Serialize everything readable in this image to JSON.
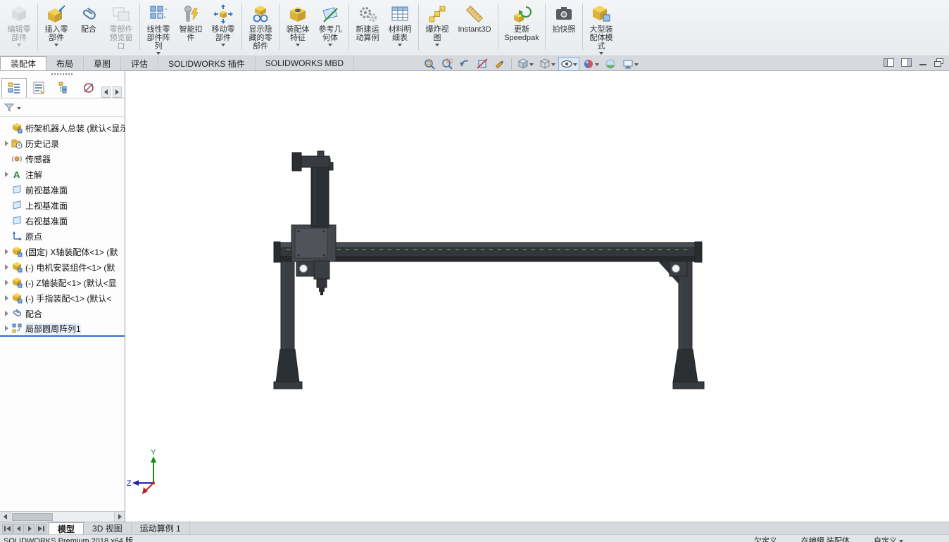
{
  "cmd": {
    "buttons": [
      {
        "label": "编辑零部件",
        "icon": "edit-component-icon",
        "disabled": true,
        "dropdown": true
      },
      {
        "label": "插入零部件",
        "icon": "insert-component-icon",
        "dropdown": true
      },
      {
        "label": "配合",
        "icon": "mate-icon"
      },
      {
        "label": "零部件预览窗口",
        "icon": "component-preview-icon",
        "disabled": true
      },
      {
        "label": "线性零部件阵列",
        "icon": "linear-pattern-icon",
        "dropdown": true
      },
      {
        "label": "智能扣件",
        "icon": "smart-fasteners-icon"
      },
      {
        "label": "移动零部件",
        "icon": "move-component-icon",
        "dropdown": true
      },
      {
        "label": "显示隐藏的零部件",
        "icon": "show-hidden-components-icon"
      },
      {
        "label": "装配体特征",
        "icon": "assembly-features-icon",
        "dropdown": true
      },
      {
        "label": "参考几何体",
        "icon": "reference-geometry-icon",
        "dropdown": true
      },
      {
        "label": "新建运动算例",
        "icon": "new-motion-study-icon"
      },
      {
        "label": "材料明细表",
        "icon": "bill-of-materials-icon",
        "dropdown": true
      },
      {
        "label": "爆炸视图",
        "icon": "exploded-view-icon",
        "dropdown": true
      },
      {
        "label": "Instant3D",
        "icon": "instant3d-icon"
      },
      {
        "label": "更新 Speedpak",
        "icon": "update-speedpak-icon"
      },
      {
        "label": "拍快照",
        "icon": "take-snapshot-icon"
      },
      {
        "label": "大型装配体模式",
        "icon": "large-assembly-mode-icon",
        "dropdown": true
      }
    ]
  },
  "ribbon": {
    "tabs": [
      {
        "label": "装配体",
        "active": true
      },
      {
        "label": "布局"
      },
      {
        "label": "草图"
      },
      {
        "label": "评估"
      },
      {
        "label": "SOLIDWORKS 插件"
      },
      {
        "label": "SOLIDWORKS MBD"
      }
    ]
  },
  "hud": {
    "icons": [
      "zoom-fit-icon",
      "zoom-area-icon",
      "previous-view-icon",
      "section-view-icon",
      "magnify-icon",
      "view-orientation-icon",
      "display-style-icon",
      "hide-show-items-icon",
      "edit-appearance-icon",
      "apply-scene-icon",
      "view-settings-icon"
    ]
  },
  "window_controls": {
    "icons": [
      "pane-left-icon",
      "pane-right-icon",
      "minimize-commandmanager-icon",
      "restore-pane-icon"
    ]
  },
  "panel": {
    "tabs": [
      "featuremanager-tree",
      "propertymanager",
      "configurationmanager",
      "dimxpertmanager"
    ],
    "filter_icon": "filter-funnel-icon"
  },
  "tree": {
    "items": [
      {
        "label": "桁架机器人总装 (默认<显示",
        "icon": "assembly-icon"
      },
      {
        "label": "历史记录",
        "icon": "history-folder-icon",
        "expandable": true
      },
      {
        "label": "传感器",
        "icon": "sensors-icon"
      },
      {
        "label": "注解",
        "icon": "annotations-icon",
        "expandable": true
      },
      {
        "label": "前视基准面",
        "icon": "plane-icon"
      },
      {
        "label": "上视基准面",
        "icon": "plane-icon"
      },
      {
        "label": "右视基准面",
        "icon": "plane-icon"
      },
      {
        "label": "原点",
        "icon": "origin-icon"
      },
      {
        "label": "(固定) X轴装配体<1> (默",
        "icon": "component-icon",
        "expandable": true
      },
      {
        "label": "(-) 电机安装组件<1> (默",
        "icon": "component-icon",
        "expandable": true
      },
      {
        "label": "(-) Z轴装配<1> (默认<显",
        "icon": "component-icon",
        "expandable": true
      },
      {
        "label": "(-) 手指装配<1> (默认<",
        "icon": "component-icon",
        "expandable": true
      },
      {
        "label": "配合",
        "icon": "mates-icon",
        "expandable": true
      },
      {
        "label": "局部圆周阵列1",
        "icon": "pattern-icon",
        "expandable": true,
        "selected": true
      }
    ]
  },
  "viewport": {
    "triad_y": "Y",
    "triad_z": "Z"
  },
  "doc": {
    "tabs": [
      {
        "label": "模型",
        "active": true
      },
      {
        "label": "3D 视图"
      },
      {
        "label": "运动算例 1"
      }
    ]
  },
  "status": {
    "left": "SOLIDWORKS Premium 2018 x64 版",
    "defined_state": "欠定义",
    "editing_state": "在编辑 装配体",
    "custom_label": "自定义"
  }
}
